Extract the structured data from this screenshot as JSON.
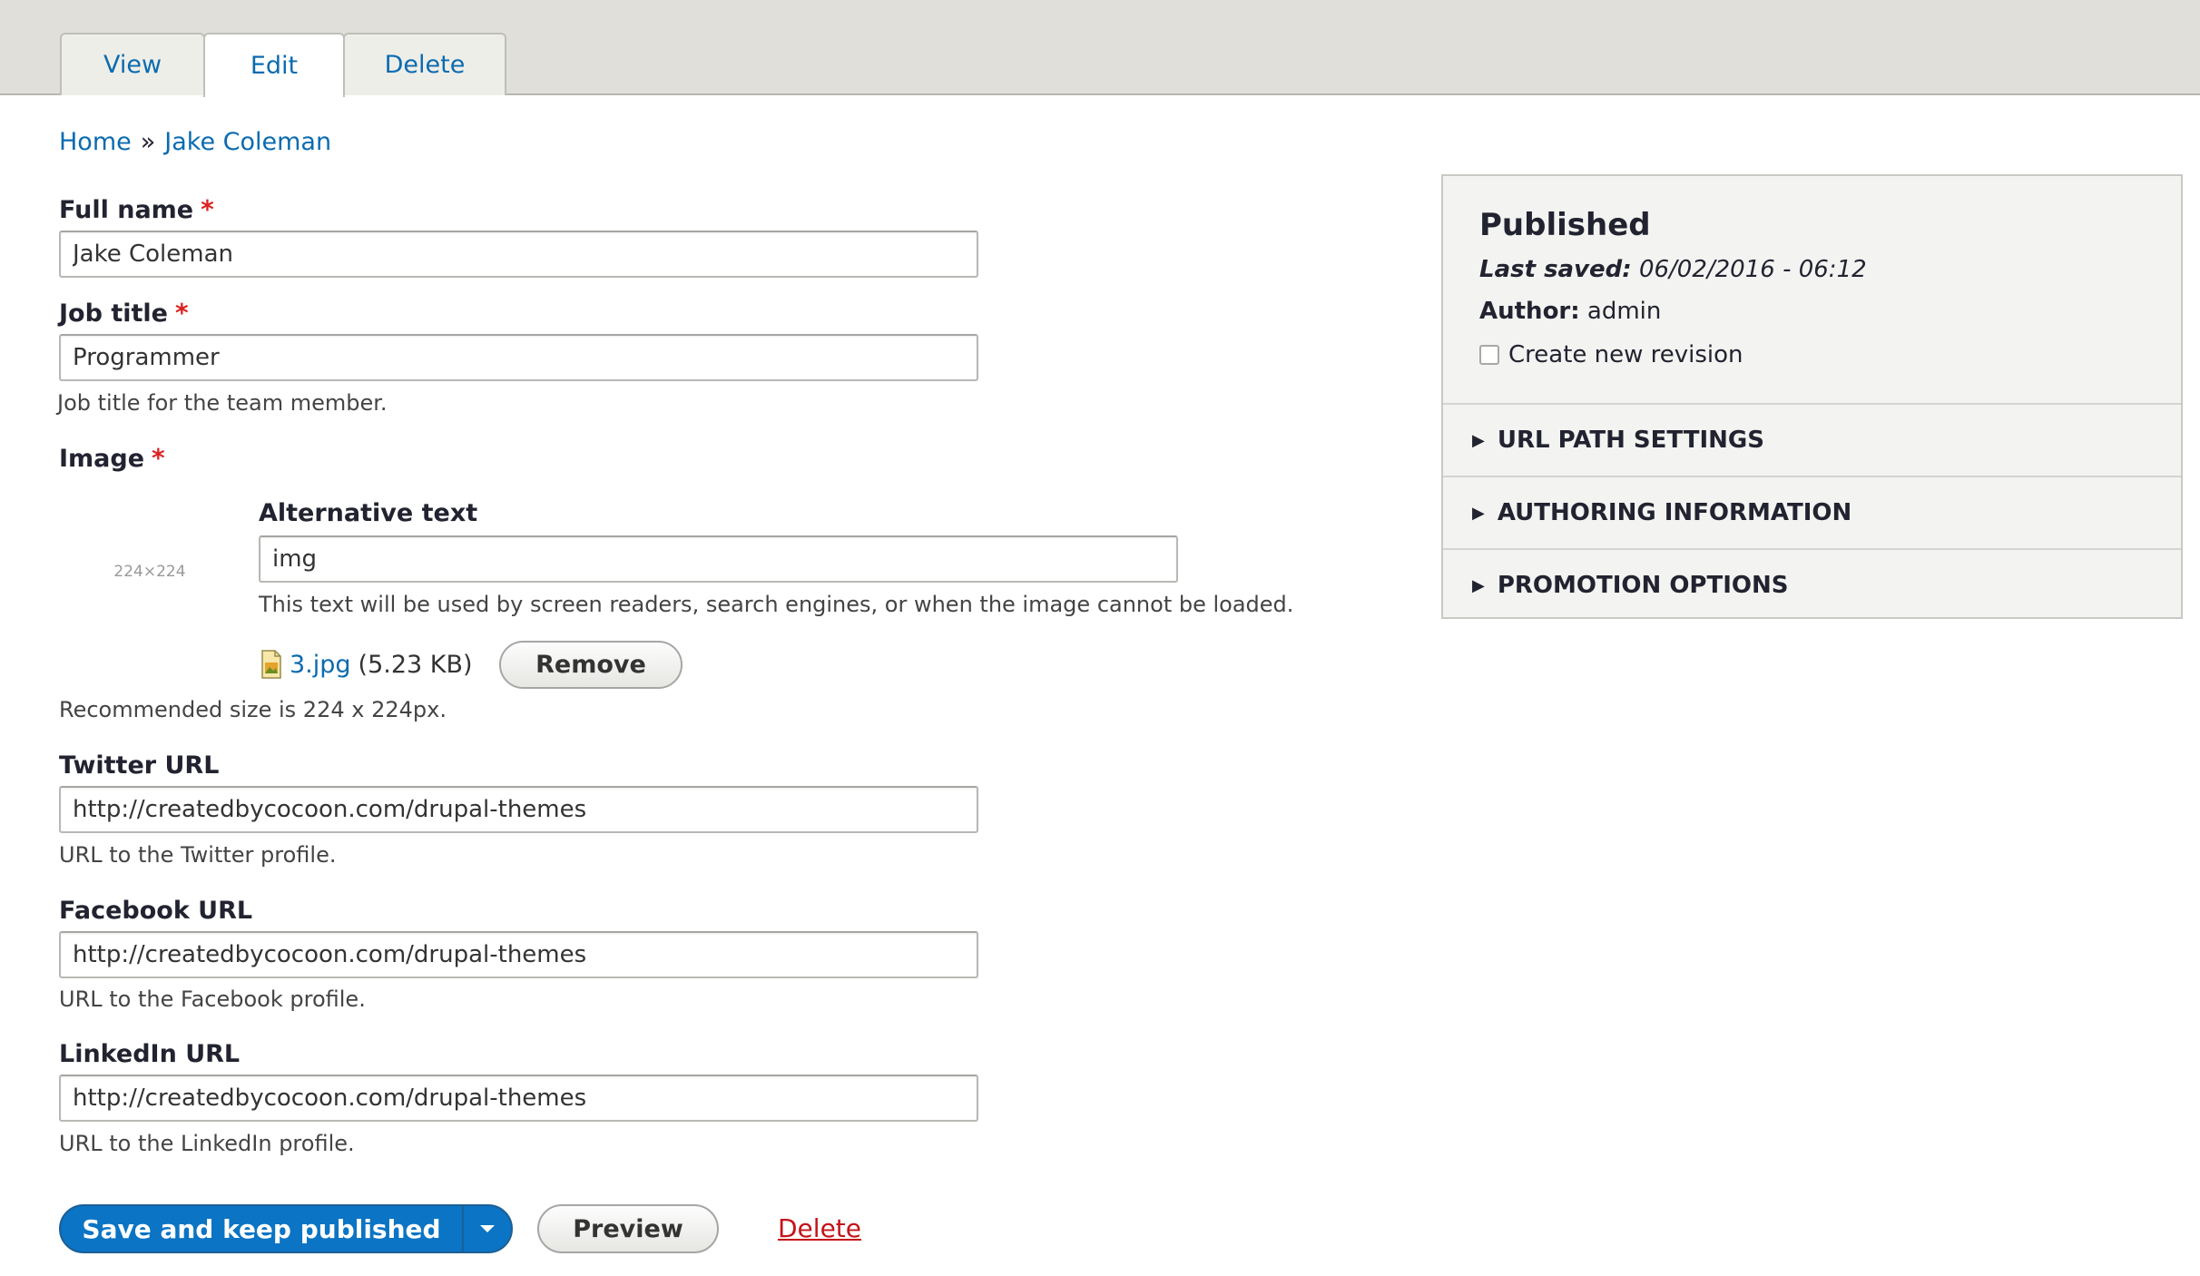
{
  "tabs": [
    {
      "label": "View",
      "active": false
    },
    {
      "label": "Edit",
      "active": true
    },
    {
      "label": "Delete",
      "active": false
    }
  ],
  "breadcrumb": {
    "home": "Home",
    "separator": "»",
    "current": "Jake Coleman"
  },
  "form": {
    "full_name": {
      "label": "Full name",
      "value": "Jake Coleman"
    },
    "job_title": {
      "label": "Job title",
      "value": "Programmer",
      "description": "Job title for the team member."
    },
    "image": {
      "label": "Image",
      "thumbnail_text": "224×224",
      "alt_label": "Alternative text",
      "alt_value": "img",
      "alt_description": "This text will be used by screen readers, search engines, or when the image cannot be loaded.",
      "file_name": "3.jpg",
      "file_size": "(5.23 KB)",
      "remove_label": "Remove",
      "recommendation": "Recommended size is 224 x 224px."
    },
    "twitter": {
      "label": "Twitter URL",
      "value": "http://createdbycocoon.com/drupal-themes",
      "description": "URL to the Twitter profile."
    },
    "facebook": {
      "label": "Facebook URL",
      "value": "http://createdbycocoon.com/drupal-themes",
      "description": "URL to the Facebook profile."
    },
    "linkedin": {
      "label": "LinkedIn URL",
      "value": "http://createdbycocoon.com/drupal-themes",
      "description": "URL to the LinkedIn profile."
    },
    "required_marker": "*"
  },
  "actions": {
    "save": "Save and keep published",
    "preview": "Preview",
    "delete": "Delete"
  },
  "sidebar": {
    "status": "Published",
    "last_saved_label": "Last saved:",
    "last_saved_value": "06/02/2016 - 06:12",
    "author_label": "Author:",
    "author_value": "admin",
    "revision_label": "Create new revision",
    "revision_checked": false,
    "sections": [
      "URL PATH SETTINGS",
      "AUTHORING INFORMATION",
      "PROMOTION OPTIONS"
    ]
  },
  "colors": {
    "link": "#0b6bb0",
    "primary": "#0b74c4",
    "required": "#dc2323",
    "danger": "#c4141a",
    "tabbar": "#e0dfd9"
  }
}
